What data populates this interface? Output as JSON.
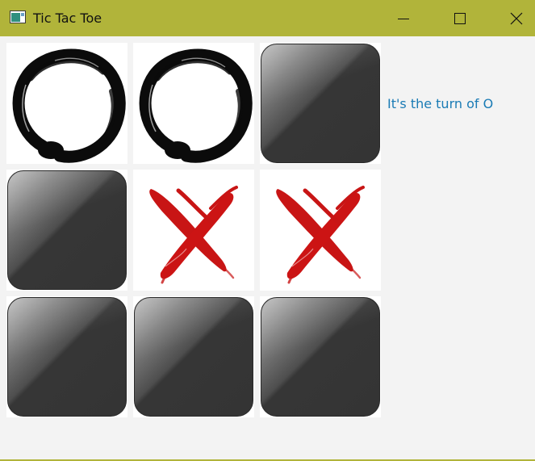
{
  "window": {
    "title": "Tic Tac Toe",
    "accent_color": "#b1b43a"
  },
  "board": {
    "cells": [
      "O",
      "O",
      "",
      "",
      "X",
      "X",
      "",
      "",
      ""
    ]
  },
  "status": {
    "text": "It's the turn of O",
    "color": "#1a7bb5"
  },
  "icons": {
    "app": "app-window-icon",
    "minimize": "minimize-icon",
    "maximize": "maximize-icon",
    "close": "close-icon",
    "o_mark": "enso-circle-icon",
    "x_mark": "red-brush-x-icon"
  }
}
